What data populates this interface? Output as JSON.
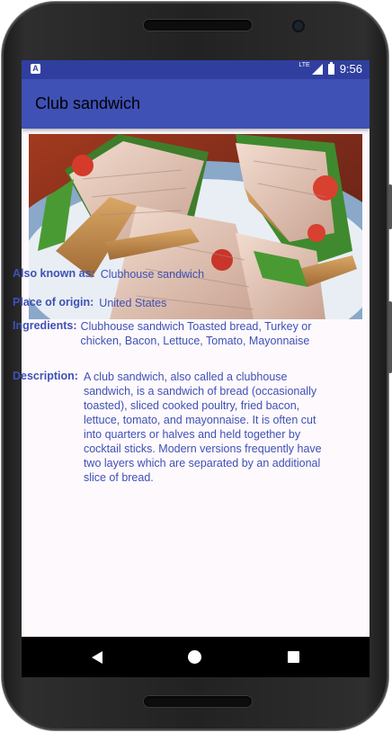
{
  "status_bar": {
    "notification_icon": "A",
    "network": "LTE",
    "time": "9:56"
  },
  "app_bar": {
    "title": "Club sandwich"
  },
  "image": {
    "subject": "club-sandwich-photo"
  },
  "details": {
    "also_known_as_label": "Also known as:",
    "also_known_as_value": "Clubhouse sandwich",
    "origin_label": "Place of origin:",
    "origin_value": "United States",
    "ingredients_label": "Ingredients:",
    "ingredients_value": "Clubhouse sandwich Toasted bread, Turkey or chicken, Bacon, Lettuce, Tomato, Mayonnaise",
    "description_label": "Description:",
    "description_value": "A club sandwich, also called a clubhouse sandwich, is a sandwich of bread (occasionally toasted), sliced cooked poultry, fried bacon, lettuce, tomato, and mayonnaise. It is often cut into quarters or halves and held together by cocktail sticks. Modern versions frequently have two layers which are separated by an additional slice of bread."
  },
  "colors": {
    "status_bar": "#303f9f",
    "app_bar": "#3f51b5",
    "text": "#3f51b5",
    "background": "#fdf9fd"
  },
  "nav_bar": {
    "icons": [
      "back-icon",
      "home-icon",
      "recent-apps-icon"
    ]
  }
}
